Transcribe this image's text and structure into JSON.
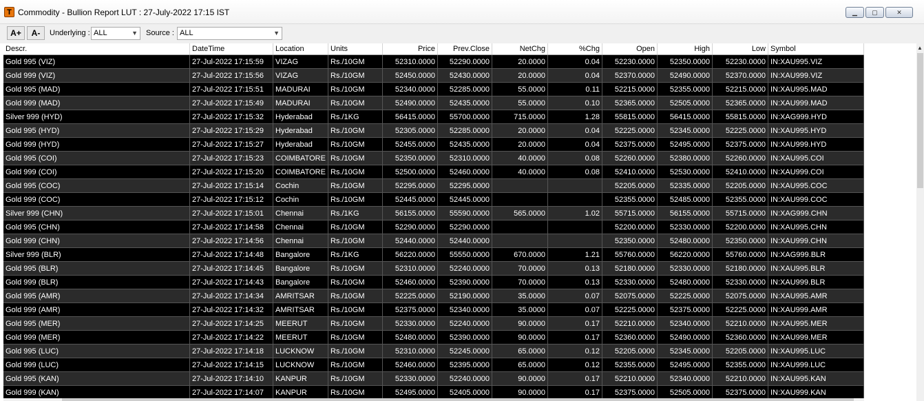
{
  "window": {
    "title": "Commodity - Bullion Report  LUT : 27-July-2022 17:15 IST",
    "icon_letter": "T",
    "minimize_glyph": "▁",
    "maximize_glyph": "▢",
    "close_glyph": "✕"
  },
  "toolbar": {
    "font_increase": "A+",
    "font_decrease": "A-",
    "underlying_label": "Underlying :",
    "underlying_value": "ALL",
    "source_label": "Source :",
    "source_value": "ALL"
  },
  "columns": [
    "Descr.",
    "DateTime",
    "Location",
    "Units",
    "Price",
    "Prev.Close",
    "NetChg",
    "%Chg",
    "Open",
    "High",
    "Low",
    "Symbol"
  ],
  "rows": [
    [
      "Gold 995 (VIZ)",
      "27-Jul-2022 17:15:59",
      "VIZAG",
      "Rs./10GM",
      "52310.0000",
      "52290.0000",
      "20.0000",
      "0.04",
      "52230.0000",
      "52350.0000",
      "52230.0000",
      "IN:XAU995.VIZ"
    ],
    [
      "Gold 999 (VIZ)",
      "27-Jul-2022 17:15:56",
      "VIZAG",
      "Rs./10GM",
      "52450.0000",
      "52430.0000",
      "20.0000",
      "0.04",
      "52370.0000",
      "52490.0000",
      "52370.0000",
      "IN:XAU999.VIZ"
    ],
    [
      "Gold 995 (MAD)",
      "27-Jul-2022 17:15:51",
      "MADURAI",
      "Rs./10GM",
      "52340.0000",
      "52285.0000",
      "55.0000",
      "0.11",
      "52215.0000",
      "52355.0000",
      "52215.0000",
      "IN:XAU995.MAD"
    ],
    [
      "Gold 999 (MAD)",
      "27-Jul-2022 17:15:49",
      "MADURAI",
      "Rs./10GM",
      "52490.0000",
      "52435.0000",
      "55.0000",
      "0.10",
      "52365.0000",
      "52505.0000",
      "52365.0000",
      "IN:XAU999.MAD"
    ],
    [
      "Silver 999 (HYD)",
      "27-Jul-2022 17:15:32",
      "Hyderabad",
      "Rs./1KG",
      "56415.0000",
      "55700.0000",
      "715.0000",
      "1.28",
      "55815.0000",
      "56415.0000",
      "55815.0000",
      "IN:XAG999.HYD"
    ],
    [
      "Gold 995 (HYD)",
      "27-Jul-2022 17:15:29",
      "Hyderabad",
      "Rs./10GM",
      "52305.0000",
      "52285.0000",
      "20.0000",
      "0.04",
      "52225.0000",
      "52345.0000",
      "52225.0000",
      "IN:XAU995.HYD"
    ],
    [
      "Gold 999 (HYD)",
      "27-Jul-2022 17:15:27",
      "Hyderabad",
      "Rs./10GM",
      "52455.0000",
      "52435.0000",
      "20.0000",
      "0.04",
      "52375.0000",
      "52495.0000",
      "52375.0000",
      "IN:XAU999.HYD"
    ],
    [
      "Gold 995 (COI)",
      "27-Jul-2022 17:15:23",
      "COIMBATORE",
      "Rs./10GM",
      "52350.0000",
      "52310.0000",
      "40.0000",
      "0.08",
      "52260.0000",
      "52380.0000",
      "52260.0000",
      "IN:XAU995.COI"
    ],
    [
      "Gold 999 (COI)",
      "27-Jul-2022 17:15:20",
      "COIMBATORE",
      "Rs./10GM",
      "52500.0000",
      "52460.0000",
      "40.0000",
      "0.08",
      "52410.0000",
      "52530.0000",
      "52410.0000",
      "IN:XAU999.COI"
    ],
    [
      "Gold 995 (COC)",
      "27-Jul-2022 17:15:14",
      "Cochin",
      "Rs./10GM",
      "52295.0000",
      "52295.0000",
      "",
      "",
      "52205.0000",
      "52335.0000",
      "52205.0000",
      "IN:XAU995.COC"
    ],
    [
      "Gold 999 (COC)",
      "27-Jul-2022 17:15:12",
      "Cochin",
      "Rs./10GM",
      "52445.0000",
      "52445.0000",
      "",
      "",
      "52355.0000",
      "52485.0000",
      "52355.0000",
      "IN:XAU999.COC"
    ],
    [
      "Silver 999 (CHN)",
      "27-Jul-2022 17:15:01",
      "Chennai",
      "Rs./1KG",
      "56155.0000",
      "55590.0000",
      "565.0000",
      "1.02",
      "55715.0000",
      "56155.0000",
      "55715.0000",
      "IN:XAG999.CHN"
    ],
    [
      "Gold 995 (CHN)",
      "27-Jul-2022 17:14:58",
      "Chennai",
      "Rs./10GM",
      "52290.0000",
      "52290.0000",
      "",
      "",
      "52200.0000",
      "52330.0000",
      "52200.0000",
      "IN:XAU995.CHN"
    ],
    [
      "Gold 999 (CHN)",
      "27-Jul-2022 17:14:56",
      "Chennai",
      "Rs./10GM",
      "52440.0000",
      "52440.0000",
      "",
      "",
      "52350.0000",
      "52480.0000",
      "52350.0000",
      "IN:XAU999.CHN"
    ],
    [
      "Silver 999 (BLR)",
      "27-Jul-2022 17:14:48",
      "Bangalore",
      "Rs./1KG",
      "56220.0000",
      "55550.0000",
      "670.0000",
      "1.21",
      "55760.0000",
      "56220.0000",
      "55760.0000",
      "IN:XAG999.BLR"
    ],
    [
      "Gold 995 (BLR)",
      "27-Jul-2022 17:14:45",
      "Bangalore",
      "Rs./10GM",
      "52310.0000",
      "52240.0000",
      "70.0000",
      "0.13",
      "52180.0000",
      "52330.0000",
      "52180.0000",
      "IN:XAU995.BLR"
    ],
    [
      "Gold 999 (BLR)",
      "27-Jul-2022 17:14:43",
      "Bangalore",
      "Rs./10GM",
      "52460.0000",
      "52390.0000",
      "70.0000",
      "0.13",
      "52330.0000",
      "52480.0000",
      "52330.0000",
      "IN:XAU999.BLR"
    ],
    [
      "Gold 995 (AMR)",
      "27-Jul-2022 17:14:34",
      "AMRITSAR",
      "Rs./10GM",
      "52225.0000",
      "52190.0000",
      "35.0000",
      "0.07",
      "52075.0000",
      "52225.0000",
      "52075.0000",
      "IN:XAU995.AMR"
    ],
    [
      "Gold 999 (AMR)",
      "27-Jul-2022 17:14:32",
      "AMRITSAR",
      "Rs./10GM",
      "52375.0000",
      "52340.0000",
      "35.0000",
      "0.07",
      "52225.0000",
      "52375.0000",
      "52225.0000",
      "IN:XAU999.AMR"
    ],
    [
      "Gold 995 (MER)",
      "27-Jul-2022 17:14:25",
      "MEERUT",
      "Rs./10GM",
      "52330.0000",
      "52240.0000",
      "90.0000",
      "0.17",
      "52210.0000",
      "52340.0000",
      "52210.0000",
      "IN:XAU995.MER"
    ],
    [
      "Gold 999 (MER)",
      "27-Jul-2022 17:14:22",
      "MEERUT",
      "Rs./10GM",
      "52480.0000",
      "52390.0000",
      "90.0000",
      "0.17",
      "52360.0000",
      "52490.0000",
      "52360.0000",
      "IN:XAU999.MER"
    ],
    [
      "Gold 995 (LUC)",
      "27-Jul-2022 17:14:18",
      "LUCKNOW",
      "Rs./10GM",
      "52310.0000",
      "52245.0000",
      "65.0000",
      "0.12",
      "52205.0000",
      "52345.0000",
      "52205.0000",
      "IN:XAU995.LUC"
    ],
    [
      "Gold 999 (LUC)",
      "27-Jul-2022 17:14:15",
      "LUCKNOW",
      "Rs./10GM",
      "52460.0000",
      "52395.0000",
      "65.0000",
      "0.12",
      "52355.0000",
      "52495.0000",
      "52355.0000",
      "IN:XAU999.LUC"
    ],
    [
      "Gold 995 (KAN)",
      "27-Jul-2022 17:14:10",
      "KANPUR",
      "Rs./10GM",
      "52330.0000",
      "52240.0000",
      "90.0000",
      "0.17",
      "52210.0000",
      "52340.0000",
      "52210.0000",
      "IN:XAU995.KAN"
    ],
    [
      "Gold 999 (KAN)",
      "27-Jul-2022 17:14:07",
      "KANPUR",
      "Rs./10GM",
      "52495.0000",
      "52405.0000",
      "90.0000",
      "0.17",
      "52375.0000",
      "52505.0000",
      "52375.0000",
      "IN:XAU999.KAN"
    ]
  ]
}
